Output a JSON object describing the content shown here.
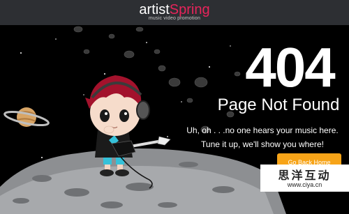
{
  "header": {
    "logo_prefix": "artist",
    "logo_brand": "Spring",
    "tagline": "music video promotion"
  },
  "error": {
    "code": "404",
    "title": "Page Not Found",
    "message_line1": "Uh, oh . . .no one hears your music here.",
    "message_line2": "Tune it up, we'll show you where!",
    "button_label": "Go Back Home"
  },
  "watermark": {
    "cn_text": "思洋互动",
    "url": "www.ciya.cn"
  },
  "colors": {
    "header_bg": "#2d2f33",
    "brand_pink": "#e8245b",
    "button_orange": "#f7a418",
    "background": "#000000"
  }
}
